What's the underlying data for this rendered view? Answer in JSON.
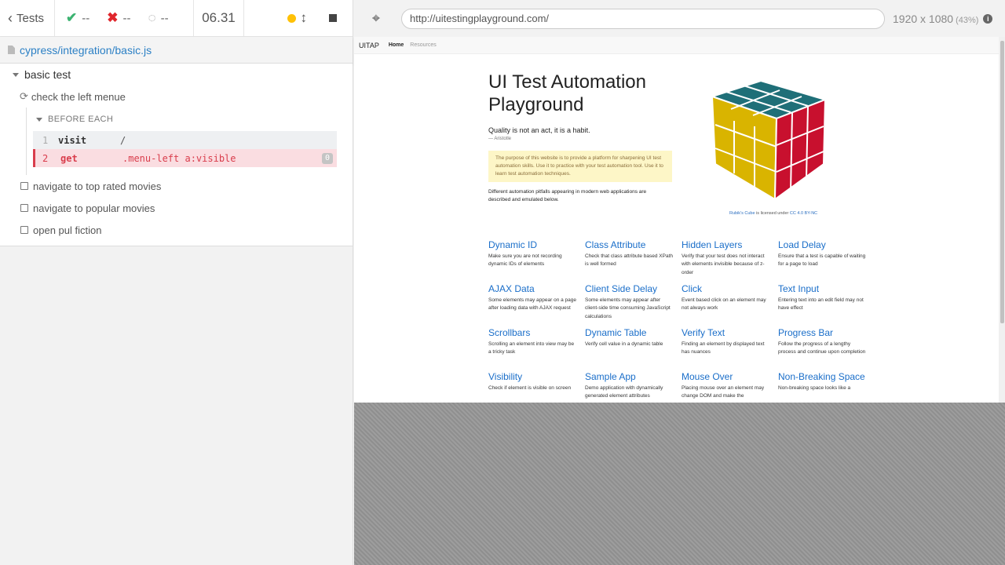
{
  "topbar": {
    "tests_label": "Tests",
    "passed": "--",
    "failed": "--",
    "pending": "--",
    "duration": "06.31"
  },
  "spec": {
    "path": "cypress/integration/basic.js"
  },
  "suite": {
    "title": "basic test",
    "running_test": "check the left menue",
    "hook_title": "BEFORE EACH",
    "commands": [
      {
        "num": "1",
        "name": "visit",
        "message": "/"
      },
      {
        "num": "2",
        "name": "get",
        "message": ".menu-left a:visible",
        "count": "0"
      }
    ],
    "pending_tests": [
      "navigate to top rated movies",
      "navigate to popular movies",
      "open pul fiction"
    ]
  },
  "aut": {
    "url": "http://uitestingplayground.com/",
    "viewport": "1920 x 1080",
    "scale": "(43%)"
  },
  "site": {
    "brand": "UITAP",
    "nav": [
      "Home",
      "Resources"
    ],
    "title": "UI Test Automation Playground",
    "quote": "Quality is not an act, it is a habit.",
    "author": "— Aristotle",
    "alert": "The purpose of this website is to provide a platform for sharpening UI test automation skills. Use it to practice with your test automation tool. Use it to learn test automation techniques.",
    "pitfalls": "Different automation pitfalls appearing in modern web applications are described and emulated below.",
    "caption": {
      "link1": "Rubik's Cube",
      "mid": " is licensed under ",
      "link2": "CC 4.0 BY-NC"
    },
    "cards": [
      {
        "title": "Dynamic ID",
        "desc": "Make sure you are not recording dynamic IDs of elements"
      },
      {
        "title": "Class Attribute",
        "desc": "Check that class attribute based XPath is well formed"
      },
      {
        "title": "Hidden Layers",
        "desc": "Verify that your test does not interact with elements invisible because of z-order"
      },
      {
        "title": "Load Delay",
        "desc": "Ensure that a test is capable of waiting for a page to load"
      },
      {
        "title": "AJAX Data",
        "desc": "Some elements may appear on a page after loading data with AJAX request"
      },
      {
        "title": "Client Side Delay",
        "desc": "Some elements may appear after client-side time consuming JavaScript calculations"
      },
      {
        "title": "Click",
        "desc": "Event based click on an element may not always work"
      },
      {
        "title": "Text Input",
        "desc": "Entering text into an edit field may not have effect"
      },
      {
        "title": "Scrollbars",
        "desc": "Scrolling an element into view may be a tricky task"
      },
      {
        "title": "Dynamic Table",
        "desc": "Verify cell value in a dynamic table"
      },
      {
        "title": "Verify Text",
        "desc": "Finding an element by displayed text has nuances"
      },
      {
        "title": "Progress Bar",
        "desc": "Follow the progress of a lengthy process and continue upon completion"
      },
      {
        "title": "Visibility",
        "desc": "Check if element is visible on screen"
      },
      {
        "title": "Sample App",
        "desc": "Demo application with dynamically generated element attributes"
      },
      {
        "title": "Mouse Over",
        "desc": "Placing mouse over an element may change DOM and make the"
      },
      {
        "title": "Non-Breaking Space",
        "desc": "Non-breaking space looks like a"
      }
    ]
  }
}
